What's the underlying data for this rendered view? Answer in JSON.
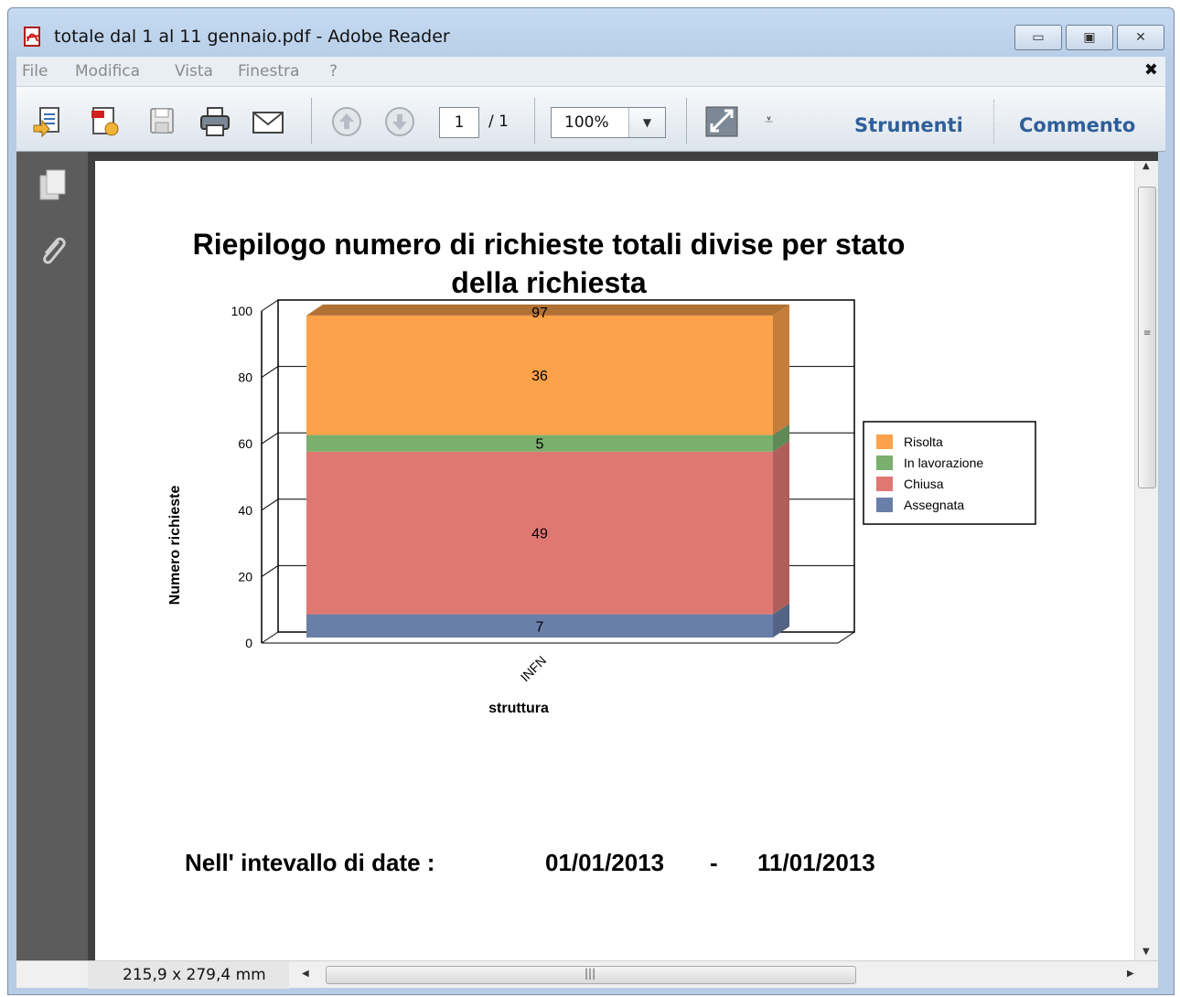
{
  "window": {
    "title": "totale dal 1 al 11 gennaio.pdf - Adobe Reader",
    "buttons": [
      "minimize",
      "maximize",
      "close"
    ]
  },
  "menu": {
    "items": [
      "File",
      "Modifica",
      "Vista",
      "Finestra",
      "?"
    ],
    "close": "✖"
  },
  "toolbar": {
    "page_current": "1",
    "page_total": "/ 1",
    "zoom": "100%",
    "tools_label": "Strumenti",
    "comment_label": "Commento"
  },
  "status": {
    "page_size": "215,9 x 279,4 mm"
  },
  "document": {
    "footer_label": "Nell' intevallo di date :",
    "date_from": "01/01/2013",
    "date_sep": "-",
    "date_to": "11/01/2013"
  },
  "chart_data": {
    "type": "bar",
    "stacked": true,
    "title": "Riepilogo numero di richieste totali divise per stato della richiesta",
    "title_lines": [
      "Riepilogo numero di richieste totali divise per stato",
      "della richiesta"
    ],
    "xlabel": "struttura",
    "ylabel": "Numero richieste",
    "categories": [
      "INFN"
    ],
    "ylim": [
      0,
      100
    ],
    "yticks": [
      0,
      20,
      40,
      60,
      80,
      100
    ],
    "series": [
      {
        "name": "Assegnata",
        "values": [
          7
        ],
        "color": "#6a7fa8"
      },
      {
        "name": "Chiusa",
        "values": [
          49
        ],
        "color": "#e07872"
      },
      {
        "name": "In lavorazione",
        "values": [
          5
        ],
        "color": "#7aaf6e"
      },
      {
        "name": "Risolta",
        "values": [
          36
        ],
        "color": "#fca24a"
      }
    ],
    "total_label": "97",
    "legend_order": [
      "Risolta",
      "In lavorazione",
      "Chiusa",
      "Assegnata"
    ],
    "legend": "right",
    "grid": true
  }
}
